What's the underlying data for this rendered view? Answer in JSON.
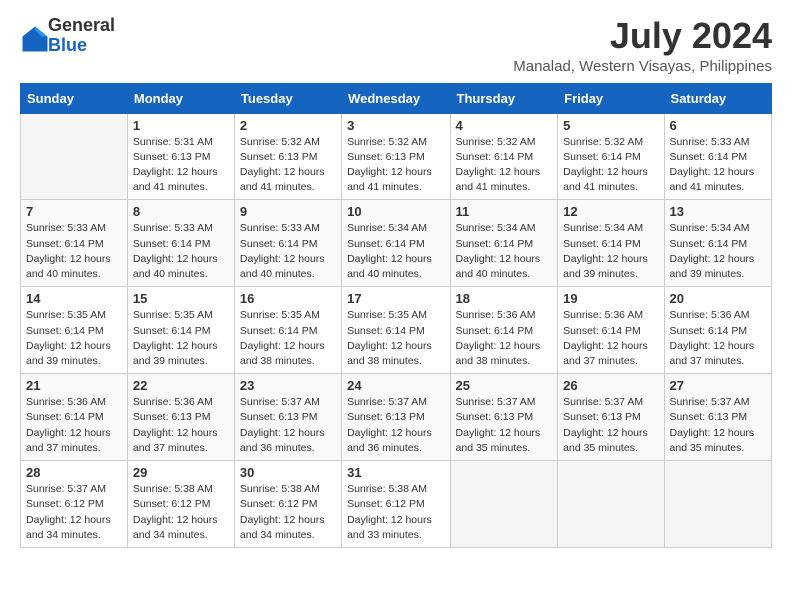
{
  "logo": {
    "general": "General",
    "blue": "Blue"
  },
  "title": "July 2024",
  "subtitle": "Manalad, Western Visayas, Philippines",
  "header": {
    "days": [
      "Sunday",
      "Monday",
      "Tuesday",
      "Wednesday",
      "Thursday",
      "Friday",
      "Saturday"
    ]
  },
  "weeks": [
    [
      {
        "day": "",
        "info": ""
      },
      {
        "day": "1",
        "info": "Sunrise: 5:31 AM\nSunset: 6:13 PM\nDaylight: 12 hours\nand 41 minutes."
      },
      {
        "day": "2",
        "info": "Sunrise: 5:32 AM\nSunset: 6:13 PM\nDaylight: 12 hours\nand 41 minutes."
      },
      {
        "day": "3",
        "info": "Sunrise: 5:32 AM\nSunset: 6:13 PM\nDaylight: 12 hours\nand 41 minutes."
      },
      {
        "day": "4",
        "info": "Sunrise: 5:32 AM\nSunset: 6:14 PM\nDaylight: 12 hours\nand 41 minutes."
      },
      {
        "day": "5",
        "info": "Sunrise: 5:32 AM\nSunset: 6:14 PM\nDaylight: 12 hours\nand 41 minutes."
      },
      {
        "day": "6",
        "info": "Sunrise: 5:33 AM\nSunset: 6:14 PM\nDaylight: 12 hours\nand 41 minutes."
      }
    ],
    [
      {
        "day": "7",
        "info": "Sunrise: 5:33 AM\nSunset: 6:14 PM\nDaylight: 12 hours\nand 40 minutes."
      },
      {
        "day": "8",
        "info": "Sunrise: 5:33 AM\nSunset: 6:14 PM\nDaylight: 12 hours\nand 40 minutes."
      },
      {
        "day": "9",
        "info": "Sunrise: 5:33 AM\nSunset: 6:14 PM\nDaylight: 12 hours\nand 40 minutes."
      },
      {
        "day": "10",
        "info": "Sunrise: 5:34 AM\nSunset: 6:14 PM\nDaylight: 12 hours\nand 40 minutes."
      },
      {
        "day": "11",
        "info": "Sunrise: 5:34 AM\nSunset: 6:14 PM\nDaylight: 12 hours\nand 40 minutes."
      },
      {
        "day": "12",
        "info": "Sunrise: 5:34 AM\nSunset: 6:14 PM\nDaylight: 12 hours\nand 39 minutes."
      },
      {
        "day": "13",
        "info": "Sunrise: 5:34 AM\nSunset: 6:14 PM\nDaylight: 12 hours\nand 39 minutes."
      }
    ],
    [
      {
        "day": "14",
        "info": "Sunrise: 5:35 AM\nSunset: 6:14 PM\nDaylight: 12 hours\nand 39 minutes."
      },
      {
        "day": "15",
        "info": "Sunrise: 5:35 AM\nSunset: 6:14 PM\nDaylight: 12 hours\nand 39 minutes."
      },
      {
        "day": "16",
        "info": "Sunrise: 5:35 AM\nSunset: 6:14 PM\nDaylight: 12 hours\nand 38 minutes."
      },
      {
        "day": "17",
        "info": "Sunrise: 5:35 AM\nSunset: 6:14 PM\nDaylight: 12 hours\nand 38 minutes."
      },
      {
        "day": "18",
        "info": "Sunrise: 5:36 AM\nSunset: 6:14 PM\nDaylight: 12 hours\nand 38 minutes."
      },
      {
        "day": "19",
        "info": "Sunrise: 5:36 AM\nSunset: 6:14 PM\nDaylight: 12 hours\nand 37 minutes."
      },
      {
        "day": "20",
        "info": "Sunrise: 5:36 AM\nSunset: 6:14 PM\nDaylight: 12 hours\nand 37 minutes."
      }
    ],
    [
      {
        "day": "21",
        "info": "Sunrise: 5:36 AM\nSunset: 6:14 PM\nDaylight: 12 hours\nand 37 minutes."
      },
      {
        "day": "22",
        "info": "Sunrise: 5:36 AM\nSunset: 6:13 PM\nDaylight: 12 hours\nand 37 minutes."
      },
      {
        "day": "23",
        "info": "Sunrise: 5:37 AM\nSunset: 6:13 PM\nDaylight: 12 hours\nand 36 minutes."
      },
      {
        "day": "24",
        "info": "Sunrise: 5:37 AM\nSunset: 6:13 PM\nDaylight: 12 hours\nand 36 minutes."
      },
      {
        "day": "25",
        "info": "Sunrise: 5:37 AM\nSunset: 6:13 PM\nDaylight: 12 hours\nand 35 minutes."
      },
      {
        "day": "26",
        "info": "Sunrise: 5:37 AM\nSunset: 6:13 PM\nDaylight: 12 hours\nand 35 minutes."
      },
      {
        "day": "27",
        "info": "Sunrise: 5:37 AM\nSunset: 6:13 PM\nDaylight: 12 hours\nand 35 minutes."
      }
    ],
    [
      {
        "day": "28",
        "info": "Sunrise: 5:37 AM\nSunset: 6:12 PM\nDaylight: 12 hours\nand 34 minutes."
      },
      {
        "day": "29",
        "info": "Sunrise: 5:38 AM\nSunset: 6:12 PM\nDaylight: 12 hours\nand 34 minutes."
      },
      {
        "day": "30",
        "info": "Sunrise: 5:38 AM\nSunset: 6:12 PM\nDaylight: 12 hours\nand 34 minutes."
      },
      {
        "day": "31",
        "info": "Sunrise: 5:38 AM\nSunset: 6:12 PM\nDaylight: 12 hours\nand 33 minutes."
      },
      {
        "day": "",
        "info": ""
      },
      {
        "day": "",
        "info": ""
      },
      {
        "day": "",
        "info": ""
      }
    ]
  ]
}
